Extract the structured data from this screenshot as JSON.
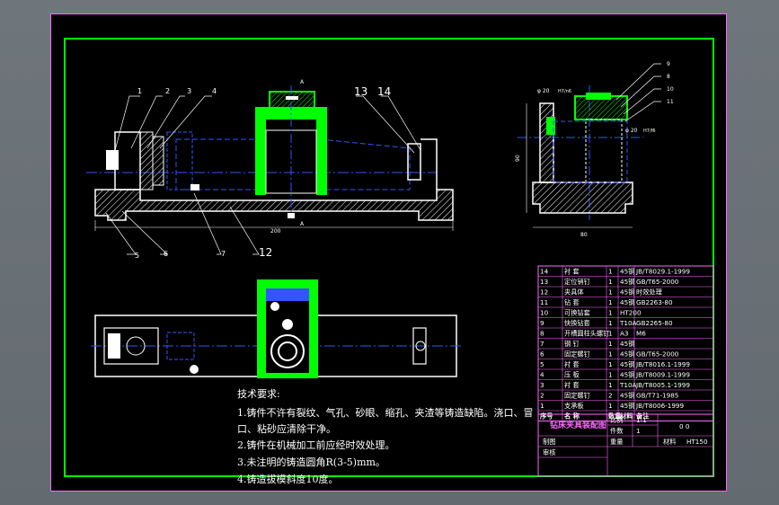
{
  "colors": {
    "frame": "#ff66ff",
    "border": "#00ff00",
    "part": "#ffffff",
    "cut": "#00ff00",
    "hatch": "#ffffff",
    "center": "#3355ff",
    "dim": "#ffffff",
    "bg": "#000000"
  },
  "callouts": {
    "main": [
      "1",
      "2",
      "3",
      "4",
      "13",
      "14",
      "5",
      "6",
      "7",
      "12"
    ],
    "side": [
      "9",
      "8",
      "10",
      "11"
    ]
  },
  "dims": {
    "width_main": "200",
    "height_side": "90",
    "width_side": "80",
    "d1": "φ 20",
    "d1_tol": "H7/n6",
    "d2": "φ 20",
    "d2_tol": "H7/f6",
    "section_a": "A",
    "section_a2": "A"
  },
  "bom": {
    "rows": [
      {
        "no": "14",
        "name": "衬 套",
        "qty": "1",
        "mat": "45钢",
        "note": "JB/T8029.1-1999"
      },
      {
        "no": "13",
        "name": "定位销钉",
        "qty": "1",
        "mat": "45钢",
        "note": "GB/T65-2000"
      },
      {
        "no": "12",
        "name": "夹具体",
        "qty": "1",
        "mat": "45钢",
        "note": "时效处理"
      },
      {
        "no": "11",
        "name": "钻 套",
        "qty": "1",
        "mat": "45钢",
        "note": "GB2263-80"
      },
      {
        "no": "10",
        "name": "可换钻套",
        "qty": "1",
        "mat": "HT200",
        "note": ""
      },
      {
        "no": "9",
        "name": "快换钻套",
        "qty": "1",
        "mat": "T10A",
        "note": "GB2265-80"
      },
      {
        "no": "8",
        "name": "开槽圆柱头螺钉",
        "qty": "1",
        "mat": "A3",
        "note": "M6"
      },
      {
        "no": "7",
        "name": "钢 钉",
        "qty": "1",
        "mat": "45钢",
        "note": ""
      },
      {
        "no": "6",
        "name": "固定螺钉",
        "qty": "1",
        "mat": "45钢",
        "note": "GB/T65-2000"
      },
      {
        "no": "5",
        "name": "衬 套",
        "qty": "1",
        "mat": "45钢",
        "note": "JB/T8016.1-1999"
      },
      {
        "no": "4",
        "name": "压 板",
        "qty": "1",
        "mat": "45钢",
        "note": "JB/T8009.1-1999"
      },
      {
        "no": "3",
        "name": "衬 套",
        "qty": "1",
        "mat": "T10A",
        "note": "JB/T8005.1-1999"
      },
      {
        "no": "2",
        "name": "固定螺钉",
        "qty": "2",
        "mat": "45钢",
        "note": "GB/T71-1985"
      },
      {
        "no": "1",
        "name": "支承板",
        "qty": "1",
        "mat": "45钢",
        "note": "JB/T8006-1999"
      }
    ],
    "header": {
      "no": "序号",
      "name": "名 称",
      "qty": "数量",
      "mat": "材料",
      "note": "备注"
    }
  },
  "titleblock": {
    "name": "钻床夹具装配图",
    "scale_label": "比例",
    "scale": "1:1",
    "sheets_label": "件数",
    "sheets": "1",
    "drawn": "制图",
    "checked": "审核",
    "weight_label": "重量",
    "material_label": "材料",
    "material": "HT150",
    "code": "0 0"
  },
  "notes": {
    "heading": "技术要求:",
    "lines": [
      "1.铸件不许有裂纹、气孔、砂眼、缩孔、夹渣等铸造缺陷。浇口、冒",
      "口、粘砂应清除干净。",
      "2.铸件在机械加工前应经时效处理。",
      "3.未注明的铸造圆角R(3-5)mm。",
      "4.铸造拔模斜度10度。"
    ]
  }
}
